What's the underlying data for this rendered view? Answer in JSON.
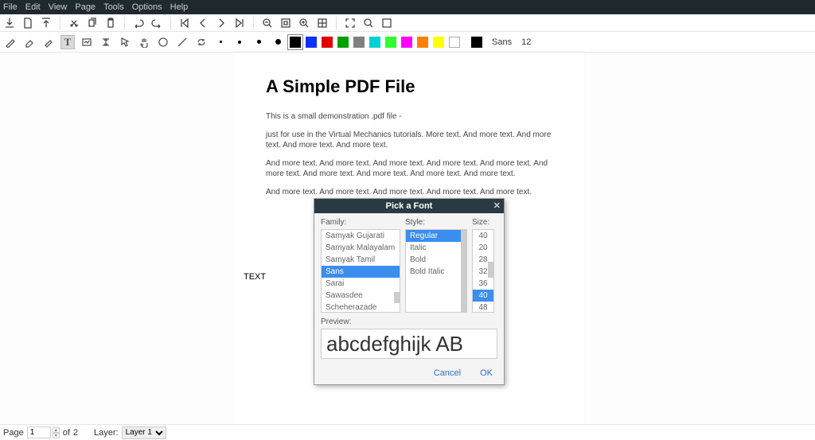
{
  "menubar": [
    "File",
    "Edit",
    "View",
    "Page",
    "Tools",
    "Options",
    "Help"
  ],
  "toolbar1_icons": [
    "download-icon",
    "new-doc-icon",
    "upload-icon",
    "cut-icon",
    "copy-icon",
    "paste-icon",
    "undo-icon",
    "redo-icon",
    "first-page-icon",
    "prev-page-icon",
    "next-page-icon",
    "last-page-icon",
    "zoom-out-icon",
    "zoom-fit-icon",
    "zoom-in-icon",
    "grid-icon",
    "fullscreen-icon",
    "search-icon",
    "select-area-icon"
  ],
  "toolbar2_icons": [
    "pen-tool-icon",
    "eraser-tool-icon",
    "highlighter-tool-icon",
    "text-tool-icon",
    "image-tool-icon",
    "vspace-tool-icon",
    "select-tool-icon",
    "hand-tool-icon",
    "shape-tool-icon",
    "line-tool-icon",
    "refresh-tool-icon"
  ],
  "pencil_points": [
    3,
    4,
    5,
    7
  ],
  "swatches": [
    {
      "color": "#000000",
      "border": "#000"
    },
    {
      "color": "#1030ff",
      "border": "#1030ff"
    },
    {
      "color": "#e00000",
      "border": "#e00000"
    },
    {
      "color": "#00a000",
      "border": "#00a000"
    },
    {
      "color": "#808080",
      "border": "#808080"
    },
    {
      "color": "#00d0d0",
      "border": "#00d0d0"
    },
    {
      "color": "#30ff30",
      "border": "#30ff30"
    },
    {
      "color": "#ff00ff",
      "border": "#ff00ff"
    },
    {
      "color": "#ff8000",
      "border": "#ff8000"
    },
    {
      "color": "#ffff00",
      "border": "#ffff00"
    },
    {
      "color": "#ffffff",
      "border": "#aaa"
    }
  ],
  "font_indicator": {
    "family": "Sans",
    "size": "12"
  },
  "document": {
    "title": "A Simple PDF File",
    "p1": "This is a small demonstration .pdf file -",
    "p2": "just for use in the Virtual Mechanics tutorials. More text. And more text. And more text. And more text. And more text.",
    "p3": "And more text. And more text. And more text. And more text. And more text. And more text. And more text. And more text. And more text. And more text.",
    "p4": "And more text. And more text. And more text. And more text. And more text."
  },
  "floating_text": "TEXT",
  "dialog": {
    "title": "Pick a Font",
    "family_label": "Family:",
    "style_label": "Style:",
    "size_label": "Size:",
    "families": [
      "Samyak Gujarati",
      "Samyak Malayalam",
      "Samyak Tamil",
      "Sans",
      "Sarai",
      "Sawasdee",
      "Scheherazade"
    ],
    "family_selected": "Sans",
    "styles": [
      "Regular",
      "Italic",
      "Bold",
      "Bold Italic"
    ],
    "style_selected": "Regular",
    "sizes": [
      "40",
      "20",
      "28",
      "32",
      "36",
      "40",
      "48"
    ],
    "size_selected_index": 5,
    "preview_label": "Preview:",
    "preview_text": "abcdefghijk AB",
    "cancel": "Cancel",
    "ok": "OK"
  },
  "statusbar": {
    "page_label": "Page",
    "current_page": "1",
    "of_label": "of",
    "total_pages": "2",
    "layer_label": "Layer:",
    "layer_value": "Layer 1"
  }
}
